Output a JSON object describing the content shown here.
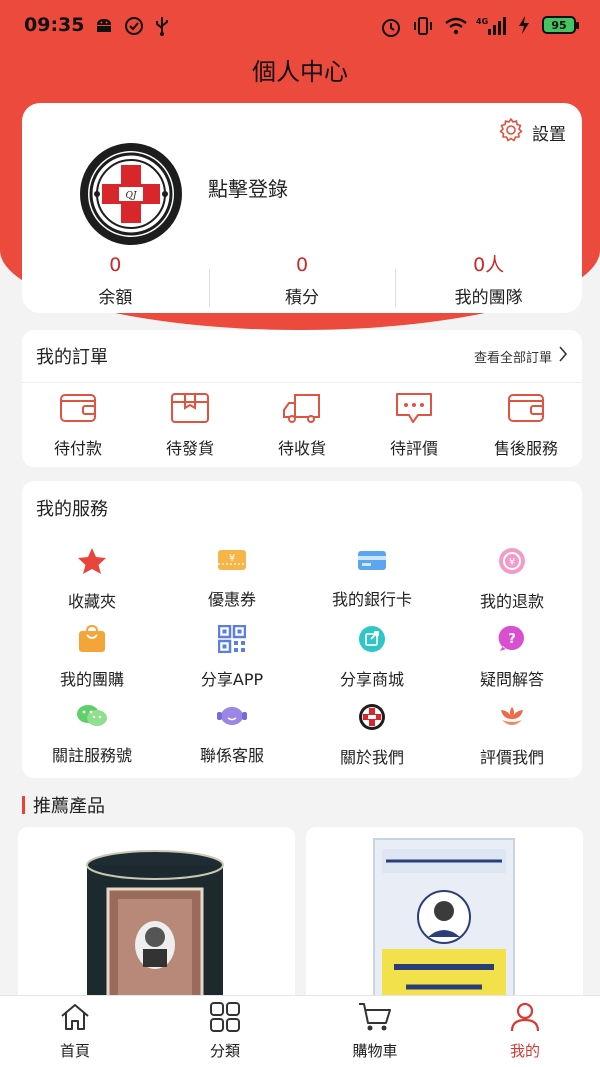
{
  "status_bar": {
    "time": "09:35",
    "battery": "95",
    "network": "4G"
  },
  "header": {
    "title": "個人中心"
  },
  "profile": {
    "settings_label": "設置",
    "login_text": "點擊登錄",
    "stats": [
      {
        "value": "0",
        "label": "余額"
      },
      {
        "value": "0",
        "label": "積分"
      },
      {
        "value": "0人",
        "label": "我的團隊"
      }
    ]
  },
  "orders": {
    "title": "我的訂單",
    "view_all": "查看全部訂單",
    "items": [
      {
        "label": "待付款",
        "icon": "wallet-icon"
      },
      {
        "label": "待發貨",
        "icon": "box-icon"
      },
      {
        "label": "待收貨",
        "icon": "truck-icon"
      },
      {
        "label": "待評價",
        "icon": "chat-bubble-icon"
      },
      {
        "label": "售後服務",
        "icon": "wallet-icon"
      }
    ]
  },
  "services": {
    "title": "我的服務",
    "items": [
      {
        "label": "收藏夾",
        "icon": "star-icon"
      },
      {
        "label": "優惠券",
        "icon": "coupon-icon"
      },
      {
        "label": "我的銀行卡",
        "icon": "bank-card-icon"
      },
      {
        "label": "我的退款",
        "icon": "refund-icon"
      },
      {
        "label": "我的團購",
        "icon": "shopping-bag-icon"
      },
      {
        "label": "分享APP",
        "icon": "qr-code-icon"
      },
      {
        "label": "分享商城",
        "icon": "share-icon"
      },
      {
        "label": "疑問解答",
        "icon": "question-icon"
      },
      {
        "label": "關註服務號",
        "icon": "wechat-icon"
      },
      {
        "label": "聯係客服",
        "icon": "customer-service-icon"
      },
      {
        "label": "關於我們",
        "icon": "logo-icon"
      },
      {
        "label": "評價我們",
        "icon": "flower-icon"
      }
    ]
  },
  "recommend": {
    "title": "推薦產品"
  },
  "tabbar": {
    "tabs": [
      {
        "label": "首頁",
        "icon": "home-icon"
      },
      {
        "label": "分類",
        "icon": "grid-icon"
      },
      {
        "label": "購物車",
        "icon": "cart-icon"
      },
      {
        "label": "我的",
        "icon": "user-icon",
        "active": true
      }
    ]
  },
  "colors": {
    "brand_red": "#ec4a3c",
    "accent_red": "#c9292a",
    "active_tab": "#d73a33"
  }
}
